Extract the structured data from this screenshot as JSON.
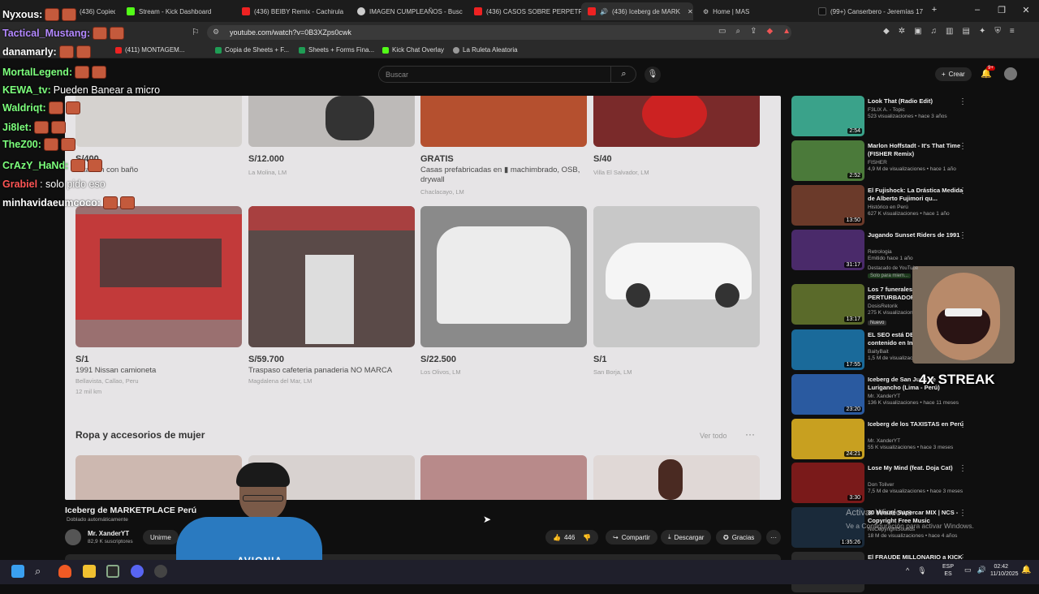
{
  "browser": {
    "tabs": [
      {
        "label": "(436) Copied... - Don Toln"
      },
      {
        "label": "Stream - Kick Dashboard"
      },
      {
        "label": "(436) BEIBY Remix - Cachirula"
      },
      {
        "label": "IMAGEN CUMPLEAÑOS - Busc"
      },
      {
        "label": "(436) CASOS SOBRE PERPETRA"
      },
      {
        "label": "(436) Iceberg de MARK"
      },
      {
        "label": "Home | MAS"
      },
      {
        "label": "(99+) Canserbero - Jeremías 17"
      }
    ],
    "url": "youtube.com/watch?v=0B3XZps0cwk",
    "bookmarks": [
      {
        "label": "(411) MONTAGEM..."
      },
      {
        "label": "Copia de Sheets + F..."
      },
      {
        "label": "Sheets + Forms Fina..."
      },
      {
        "label": "Kick Chat Overlay"
      },
      {
        "label": "La Ruleta Aleatoria"
      }
    ]
  },
  "youtube": {
    "search_placeholder": "Buscar",
    "create_label": "Crear",
    "notif_count": "9+",
    "video_title": "Iceberg de MARKETPLACE Perú",
    "dub_label": "Doblado automáticamente",
    "channel_name": "Mr. XanderYT",
    "subscribers": "82,9 K suscriptores",
    "join_label": "Unirme",
    "likes": "446",
    "share_label": "Compartir",
    "download_label": "Descargar",
    "thanks_label": "Gracias"
  },
  "marketplace": {
    "row1": [
      {
        "price": "S/400",
        "title": "...itación con baño",
        "loc": ""
      },
      {
        "price": "S/12.000",
        "title": "",
        "loc": "La Molina, LM"
      },
      {
        "price": "GRATIS",
        "title": "Casas prefabricadas en ▮ machimbrado, OSB, drywall",
        "loc": "Chaclacayo, LM"
      },
      {
        "price": "S/40",
        "title": "",
        "loc": "Villa El Salvador, LM"
      }
    ],
    "row2": [
      {
        "price": "S/1",
        "title": "1991 Nissan camioneta",
        "loc": "Bellavista, Callao, Peru",
        "extra": "12 mil km"
      },
      {
        "price": "S/59.700",
        "title": "Traspaso cafeteria panaderia NO MARCA",
        "loc": "Magdalena del Mar, LM",
        "extra": ""
      },
      {
        "price": "S/22.500",
        "title": "",
        "loc": "Los Olivos, LM",
        "extra": ""
      },
      {
        "price": "S/1",
        "title": "",
        "loc": "San Borja, LM",
        "extra": ""
      }
    ],
    "section_title": "Ropa y accesorios de mujer",
    "see_all": "Ver todo"
  },
  "chat": [
    {
      "user": "Nyxous:",
      "msg": "",
      "color": "#ffffff"
    },
    {
      "user": "Tactical_Mustang:",
      "msg": "",
      "color": "#b388ff"
    },
    {
      "user": "danamarly:",
      "msg": "",
      "color": "#ffffff"
    },
    {
      "user": "MortalLegend:",
      "msg": "",
      "color": "#7cff7c"
    },
    {
      "user": "KEWA_tv:",
      "msg": "Pueden Banear a micro",
      "color": "#7cff7c"
    },
    {
      "user": "Waldriqt:",
      "msg": "",
      "color": "#7cff7c"
    },
    {
      "user": "Ji8let:",
      "msg": "",
      "color": "#7cff7c"
    },
    {
      "user": "TheZ00:",
      "msg": "",
      "color": "#7cff7c"
    },
    {
      "user": "CrAzY_HaNd:",
      "msg": "",
      "color": "#7cff7c"
    },
    {
      "user": "Grabiel",
      "msg": ": solo pido eso",
      "color": "#ff5555"
    },
    {
      "user": "minhavidaeumcoco:",
      "msg": "",
      "color": "#ffffff"
    }
  ],
  "streak_label": "4x STREAK",
  "recommended": [
    {
      "title": "Look That (Radio Edit)",
      "channel": "F3LIX A. - Topic",
      "views": "523 visualizaciones • hace 3 años",
      "dur": "2:54",
      "color": "#3aa28a"
    },
    {
      "title": "Marlon Hoffstadt - It's That Time (FISHER Remix)",
      "channel": "FISHER",
      "views": "4,9 M de visualizaciones • hace 1 año",
      "dur": "2:52",
      "color": "#4b7a3a"
    },
    {
      "title": "El Fujishock: La Drástica Medida de Alberto Fujimori qu...",
      "channel": "Histórico en Perú",
      "views": "627 K visualizaciones • hace 1 año",
      "dur": "13:50",
      "color": "#6b3a2a"
    },
    {
      "title": "Jugando Sunset Riders de 1991",
      "channel": "Retrologia",
      "views": "Emitido hace 1 año",
      "dur": "31:17",
      "color": "#4a2a6a"
    },
    {
      "title": "Los 7 funerales más PERTURBADORES",
      "channel": "DosisRetorik",
      "views": "275 K visualizaciones",
      "dur": "13:17",
      "color": "#5a6a2a"
    },
    {
      "title": "EL SEO está DESTRUYENDO contenido en Int...",
      "channel": "BaityBait",
      "views": "1,5 M de visualizaciones",
      "dur": "17:55",
      "color": "#1a6a9a"
    },
    {
      "title": "Iceberg de San Juan de Lurigancho (Lima - Perú)",
      "channel": "Mr. XanderYT",
      "views": "136 K visualizaciones • hace 11 meses",
      "dur": "23:20",
      "color": "#2a5aa0"
    },
    {
      "title": "Iceberg de los TAXISTAS en Perú",
      "channel": "Mr. XanderYT",
      "views": "55 K visualizaciones • hace 3 meses",
      "dur": "24:21",
      "color": "#c8a020"
    },
    {
      "title": "Lose My Mind (feat. Doja Cat)",
      "channel": "Don Toliver",
      "views": "7,5 M de visualizaciones • hace 3 meses",
      "dur": "3:30",
      "color": "#7a1a1a"
    },
    {
      "title": "30 Minute Supercar MIX | NCS - Copyright Free Music",
      "channel": "NoCopyrightSounds",
      "views": "18 M de visualizaciones • hace 4 años",
      "dur": "1:35:26",
      "color": "#1a2a3a"
    },
    {
      "title": "El FRAUDE MILLONARIO a KICK",
      "channel": "",
      "views": "",
      "dur": "",
      "color": "#2a2a2a"
    }
  ],
  "badges": {
    "nuevo": "Nuevo",
    "destacado": "Destacado de YouTube",
    "solo": "Solo para miem..."
  },
  "activate": {
    "line1": "Activar Windows",
    "line2": "Ve a Configuración para activar Windows."
  },
  "taskbar": {
    "lang1": "ESP",
    "lang2": "ES",
    "time": "02:42",
    "date": "11/10/2025"
  }
}
